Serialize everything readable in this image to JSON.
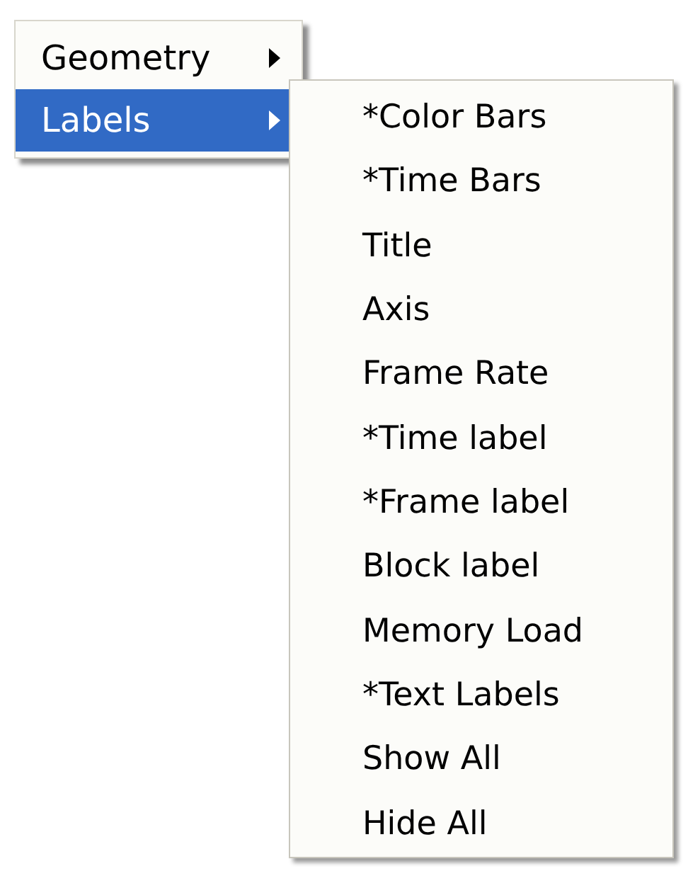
{
  "menu": {
    "items": [
      {
        "label": "Geometry",
        "selected": false,
        "has_submenu": true
      },
      {
        "label": "Labels",
        "selected": true,
        "has_submenu": true
      }
    ]
  },
  "submenu": {
    "items": [
      {
        "label": "*Color Bars"
      },
      {
        "label": "*Time Bars"
      },
      {
        "label": "Title"
      },
      {
        "label": "Axis"
      },
      {
        "label": "Frame Rate"
      },
      {
        "label": "*Time label"
      },
      {
        "label": "*Frame label"
      },
      {
        "label": "Block label"
      },
      {
        "label": "Memory Load"
      },
      {
        "label": "*Text Labels"
      },
      {
        "label": "Show All"
      },
      {
        "label": "Hide All"
      }
    ]
  }
}
